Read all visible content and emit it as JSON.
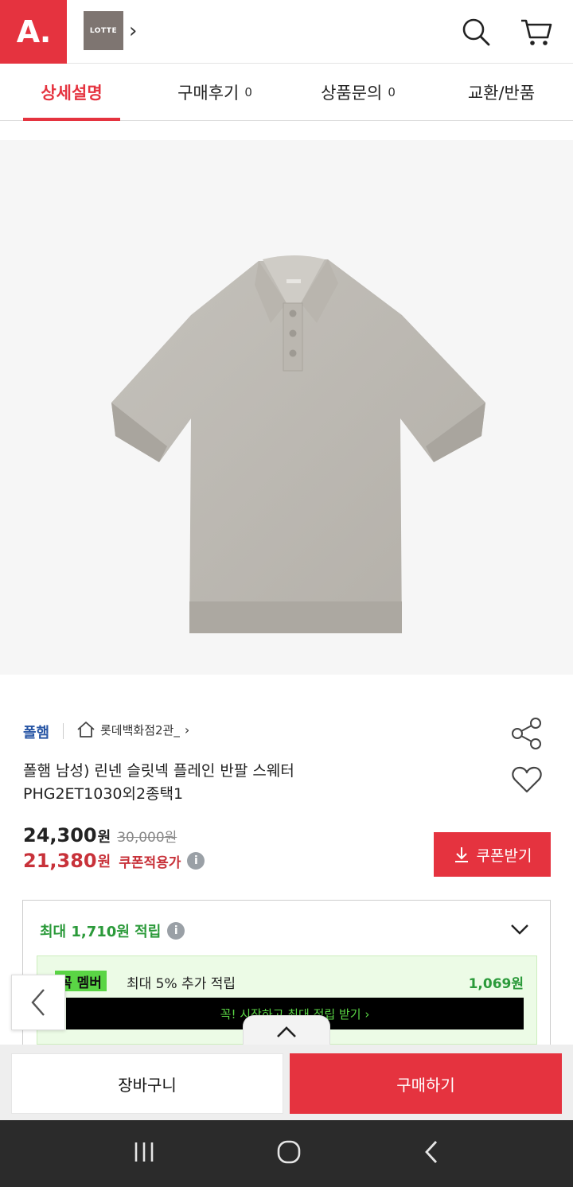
{
  "header": {
    "logo_text": "A.",
    "brand_logo_text": "LOTTE",
    "brand_chevron": "›"
  },
  "tabs": [
    {
      "label": "상세설명",
      "count": ""
    },
    {
      "label": "구매후기",
      "count": "0"
    },
    {
      "label": "상품문의",
      "count": "0"
    },
    {
      "label": "교환/반품",
      "count": ""
    }
  ],
  "product": {
    "brand": "폴햄",
    "store": "롯데백화점2관_",
    "store_chevron": "›",
    "title_line1": "폴햄 남성) 린넨 슬릿넥 플레인 반팔 스웨터",
    "title_line2": "PHG2ET1030외2종택1",
    "price": "24,300",
    "price_unit": "원",
    "original_price": "30,000원",
    "sale_price": "21,380",
    "sale_unit": "원",
    "coupon_label": "쿠폰적용가",
    "coupon_button": "쿠폰받기",
    "info_glyph": "i"
  },
  "points": {
    "title": "최대 1,710원 적립",
    "member_badge": "꼭 멤버",
    "member_text": "최대 5% 추가 적립",
    "member_amount": "1,069원",
    "member_cta": "꼭! 시작하고 최대 적립 받기 ›"
  },
  "bottom": {
    "cart": "장바구니",
    "buy": "구매하기"
  },
  "colors": {
    "accent": "#e5333f",
    "green": "#2b9a3a",
    "brand_blue": "#2856a5"
  }
}
